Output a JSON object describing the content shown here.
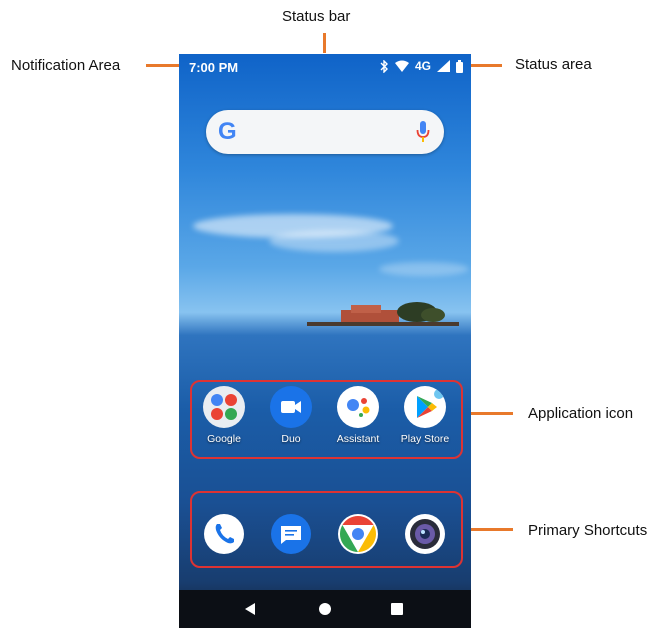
{
  "callouts": {
    "status_bar": "Status bar",
    "notification_area": "Notification Area",
    "status_area": "Status area",
    "application_icon": "Application icon",
    "primary_shortcuts": "Primary Shortcuts"
  },
  "status_bar": {
    "time": "7:00 PM",
    "network": "4G",
    "icons": [
      "bluetooth-icon",
      "wifi-icon",
      "signal-icon",
      "battery-icon"
    ]
  },
  "search": {
    "logo": "G",
    "icons": [
      "google-logo",
      "mic-icon"
    ]
  },
  "apps": [
    {
      "label": "Google",
      "icon": "google-folder-icon"
    },
    {
      "label": "Duo",
      "icon": "duo-icon"
    },
    {
      "label": "Assistant",
      "icon": "assistant-icon"
    },
    {
      "label": "Play Store",
      "icon": "play-store-icon"
    }
  ],
  "dock": [
    {
      "icon": "phone-icon"
    },
    {
      "icon": "messages-icon"
    },
    {
      "icon": "chrome-icon"
    },
    {
      "icon": "camera-icon"
    }
  ],
  "navbar": {
    "icons": [
      "back-icon",
      "home-icon",
      "recents-icon"
    ]
  },
  "colors": {
    "callout_line": "#e8792b",
    "highlight_frame": "#dd3333"
  }
}
